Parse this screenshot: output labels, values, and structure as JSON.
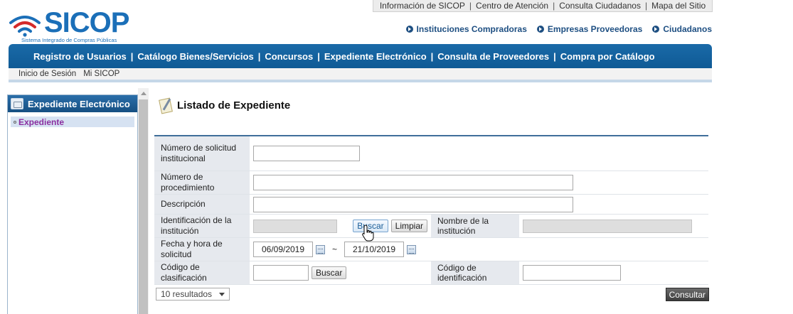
{
  "topbar": {
    "links": [
      "Información de SICOP",
      "Centro de Atención",
      "Consulta Ciudadanos",
      "Mapa del Sitio"
    ]
  },
  "logo": {
    "name": "SICOP",
    "subtitle": "Sistema Integrado de Compras Públicas",
    "color": "#1b6fb8"
  },
  "quick_links": [
    "Instituciones Compradoras",
    "Empresas Proveedoras",
    "Ciudadanos"
  ],
  "main_nav": [
    "Registro de Usuarios",
    "Catálogo Bienes/Servicios",
    "Concursos",
    "Expediente Electrónico",
    "Consulta de Proveedores",
    "Compra por Catálogo"
  ],
  "sub_nav": [
    "Inicio de Sesión",
    "Mi SICOP"
  ],
  "sidebar": {
    "title": "Expediente Electrónico",
    "items": [
      "Expediente"
    ]
  },
  "page": {
    "title": "Listado de Expediente"
  },
  "form": {
    "numero_solicitud_label": "Número de solicitud institucional",
    "numero_solicitud_value": "",
    "numero_procedimiento_label": "Número de procedimiento",
    "numero_procedimiento_value": "",
    "descripcion_label": "Descripción",
    "descripcion_value": "",
    "identificacion_label": "Identificación de la institución",
    "identificacion_value": "",
    "buscar_label": "Buscar",
    "limpiar_label": "Limpiar",
    "nombre_institucion_label": "Nombre de la institución",
    "nombre_institucion_value": "",
    "fecha_label": "Fecha y hora de solicitud",
    "fecha_desde": "06/09/2019",
    "fecha_separator": "~",
    "fecha_hasta": "21/10/2019",
    "codigo_clasificacion_label": "Código de clasificación",
    "codigo_clasificacion_value": "",
    "buscar2_label": "Buscar",
    "codigo_identificacion_label": "Código de identificación",
    "codigo_identificacion_value": ""
  },
  "results": {
    "page_size": "10 resultados",
    "consultar_label": "Consultar"
  },
  "colors": {
    "nav_blue": "#1a6aa8",
    "sidebar_item_text": "#8b2fa0",
    "label_bg": "#e6e9ee"
  }
}
